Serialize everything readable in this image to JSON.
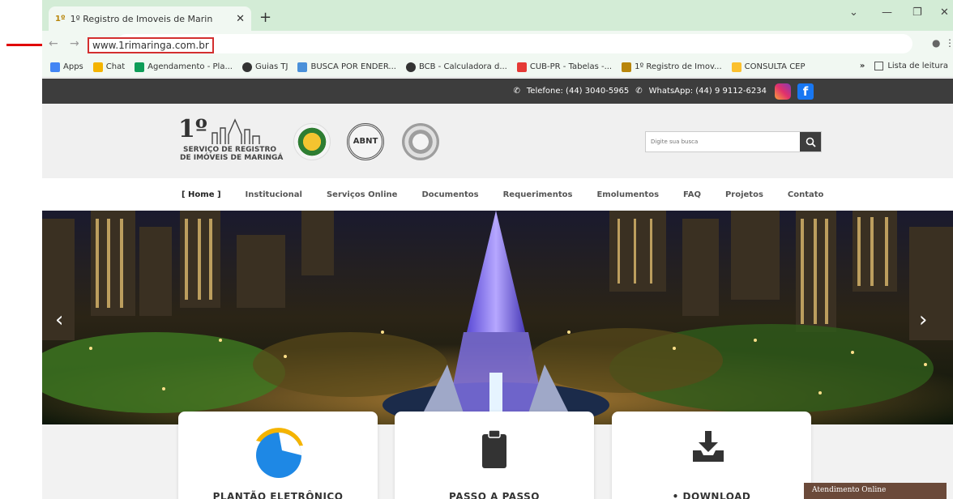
{
  "browser": {
    "tab_title": "1º Registro de Imoveis de Marin",
    "tab_favicon": "1º",
    "url": "www.1rimaringa.com.br",
    "bookmarks": [
      {
        "label": "Apps",
        "color": "#4285f4"
      },
      {
        "label": "Chat",
        "color": "#f4b400"
      },
      {
        "label": "Agendamento - Pla...",
        "color": "#0f9d58"
      },
      {
        "label": "Guias TJ",
        "color": "#333333"
      },
      {
        "label": "BUSCA POR ENDER...",
        "color": "#4a90d9"
      },
      {
        "label": "BCB - Calculadora d...",
        "color": "#333333"
      },
      {
        "label": "CUB-PR - Tabelas -...",
        "color": "#e53935"
      },
      {
        "label": "1º Registro de Imov...",
        "color": "#b8860b"
      },
      {
        "label": "CONSULTA CEP",
        "color": "#fbc02d"
      }
    ],
    "reading_list": "Lista de leitura",
    "more": "»"
  },
  "site": {
    "phone": "Telefone: (44) 3040-5965",
    "whatsapp": "WhatsApp: (44) 9 9112-6234",
    "facebook_glyph": "f",
    "logo": {
      "number": "1º",
      "line1": "SERVIÇO DE REGISTRO",
      "line2": "DE IMÓVEIS DE MARINGÁ"
    },
    "seal2_text": "ABNT",
    "search_placeholder": "Digite sua busca",
    "nav": [
      "[ Home ]",
      "Institucional",
      "Serviços Online",
      "Documentos",
      "Requerimentos",
      "Emolumentos",
      "FAQ",
      "Projetos",
      "Contato"
    ],
    "cards": [
      "PLANTÃO ELETRÔNICO",
      "PASSO A PASSO",
      "DOWNLOAD"
    ],
    "chat_label": "Atendimento Online"
  },
  "colors": {
    "tabstrip": "#d3ecd6",
    "toolbar": "#f1f8f2",
    "topbar": "#3d3d3d",
    "header": "#f0f0f0",
    "annotation_red": "#e00000",
    "chat": "#6b4a3a"
  }
}
